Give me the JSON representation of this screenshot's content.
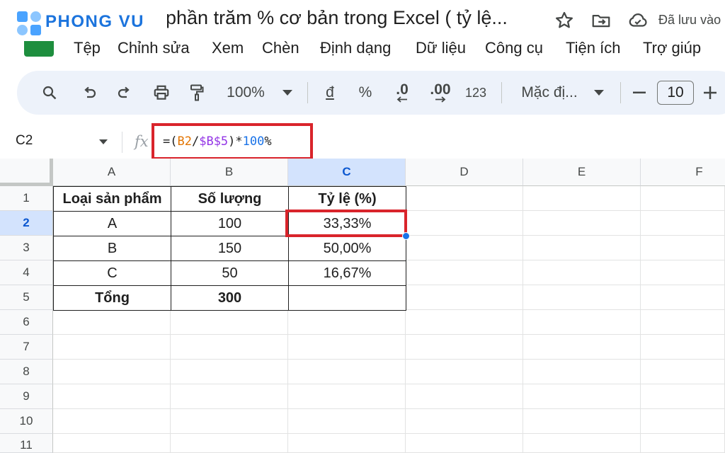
{
  "brand": {
    "name": "PHONG VU"
  },
  "document": {
    "title": "phần trăm % cơ bản trong Excel ( tỷ lệ...",
    "save_status": "Đã lưu vào"
  },
  "menu": [
    "Tệp",
    "Chỉnh sửa",
    "Xem",
    "Chèn",
    "Định dạng",
    "Dữ liệu",
    "Công cụ",
    "Tiện ích",
    "Trợ giúp"
  ],
  "toolbar": {
    "zoom": "100%",
    "currency": "đ",
    "percent": "%",
    "decrease_decimal": ".0",
    "increase_decimal": ".00",
    "number_format": "123",
    "font": "Mặc đị...",
    "font_size": "10"
  },
  "formula_bar": {
    "name_box": "C2",
    "fx": "fx",
    "formula_parts": [
      "=(",
      "B2",
      "/",
      "$B$5",
      ")*",
      "100",
      "%"
    ]
  },
  "sheet": {
    "columns": [
      "A",
      "B",
      "C",
      "D",
      "E",
      "F"
    ],
    "rows": [
      "1",
      "2",
      "3",
      "4",
      "5",
      "6",
      "7",
      "8",
      "9",
      "10",
      "11"
    ],
    "selected_cell": "C2",
    "cells": [
      [
        "Loại sản phẩm",
        "Số lượng",
        "Tỷ lệ (%)"
      ],
      [
        "A",
        "100",
        "33,33%"
      ],
      [
        "B",
        "150",
        "50,00%"
      ],
      [
        "C",
        "50",
        "16,67%"
      ],
      [
        "Tổng",
        "300",
        ""
      ]
    ]
  },
  "colors": {
    "brand": "#1c74dd",
    "highlight": "#d9242b",
    "selection": "#d3e3fd",
    "toolbar_bg": "#edf2fa"
  }
}
